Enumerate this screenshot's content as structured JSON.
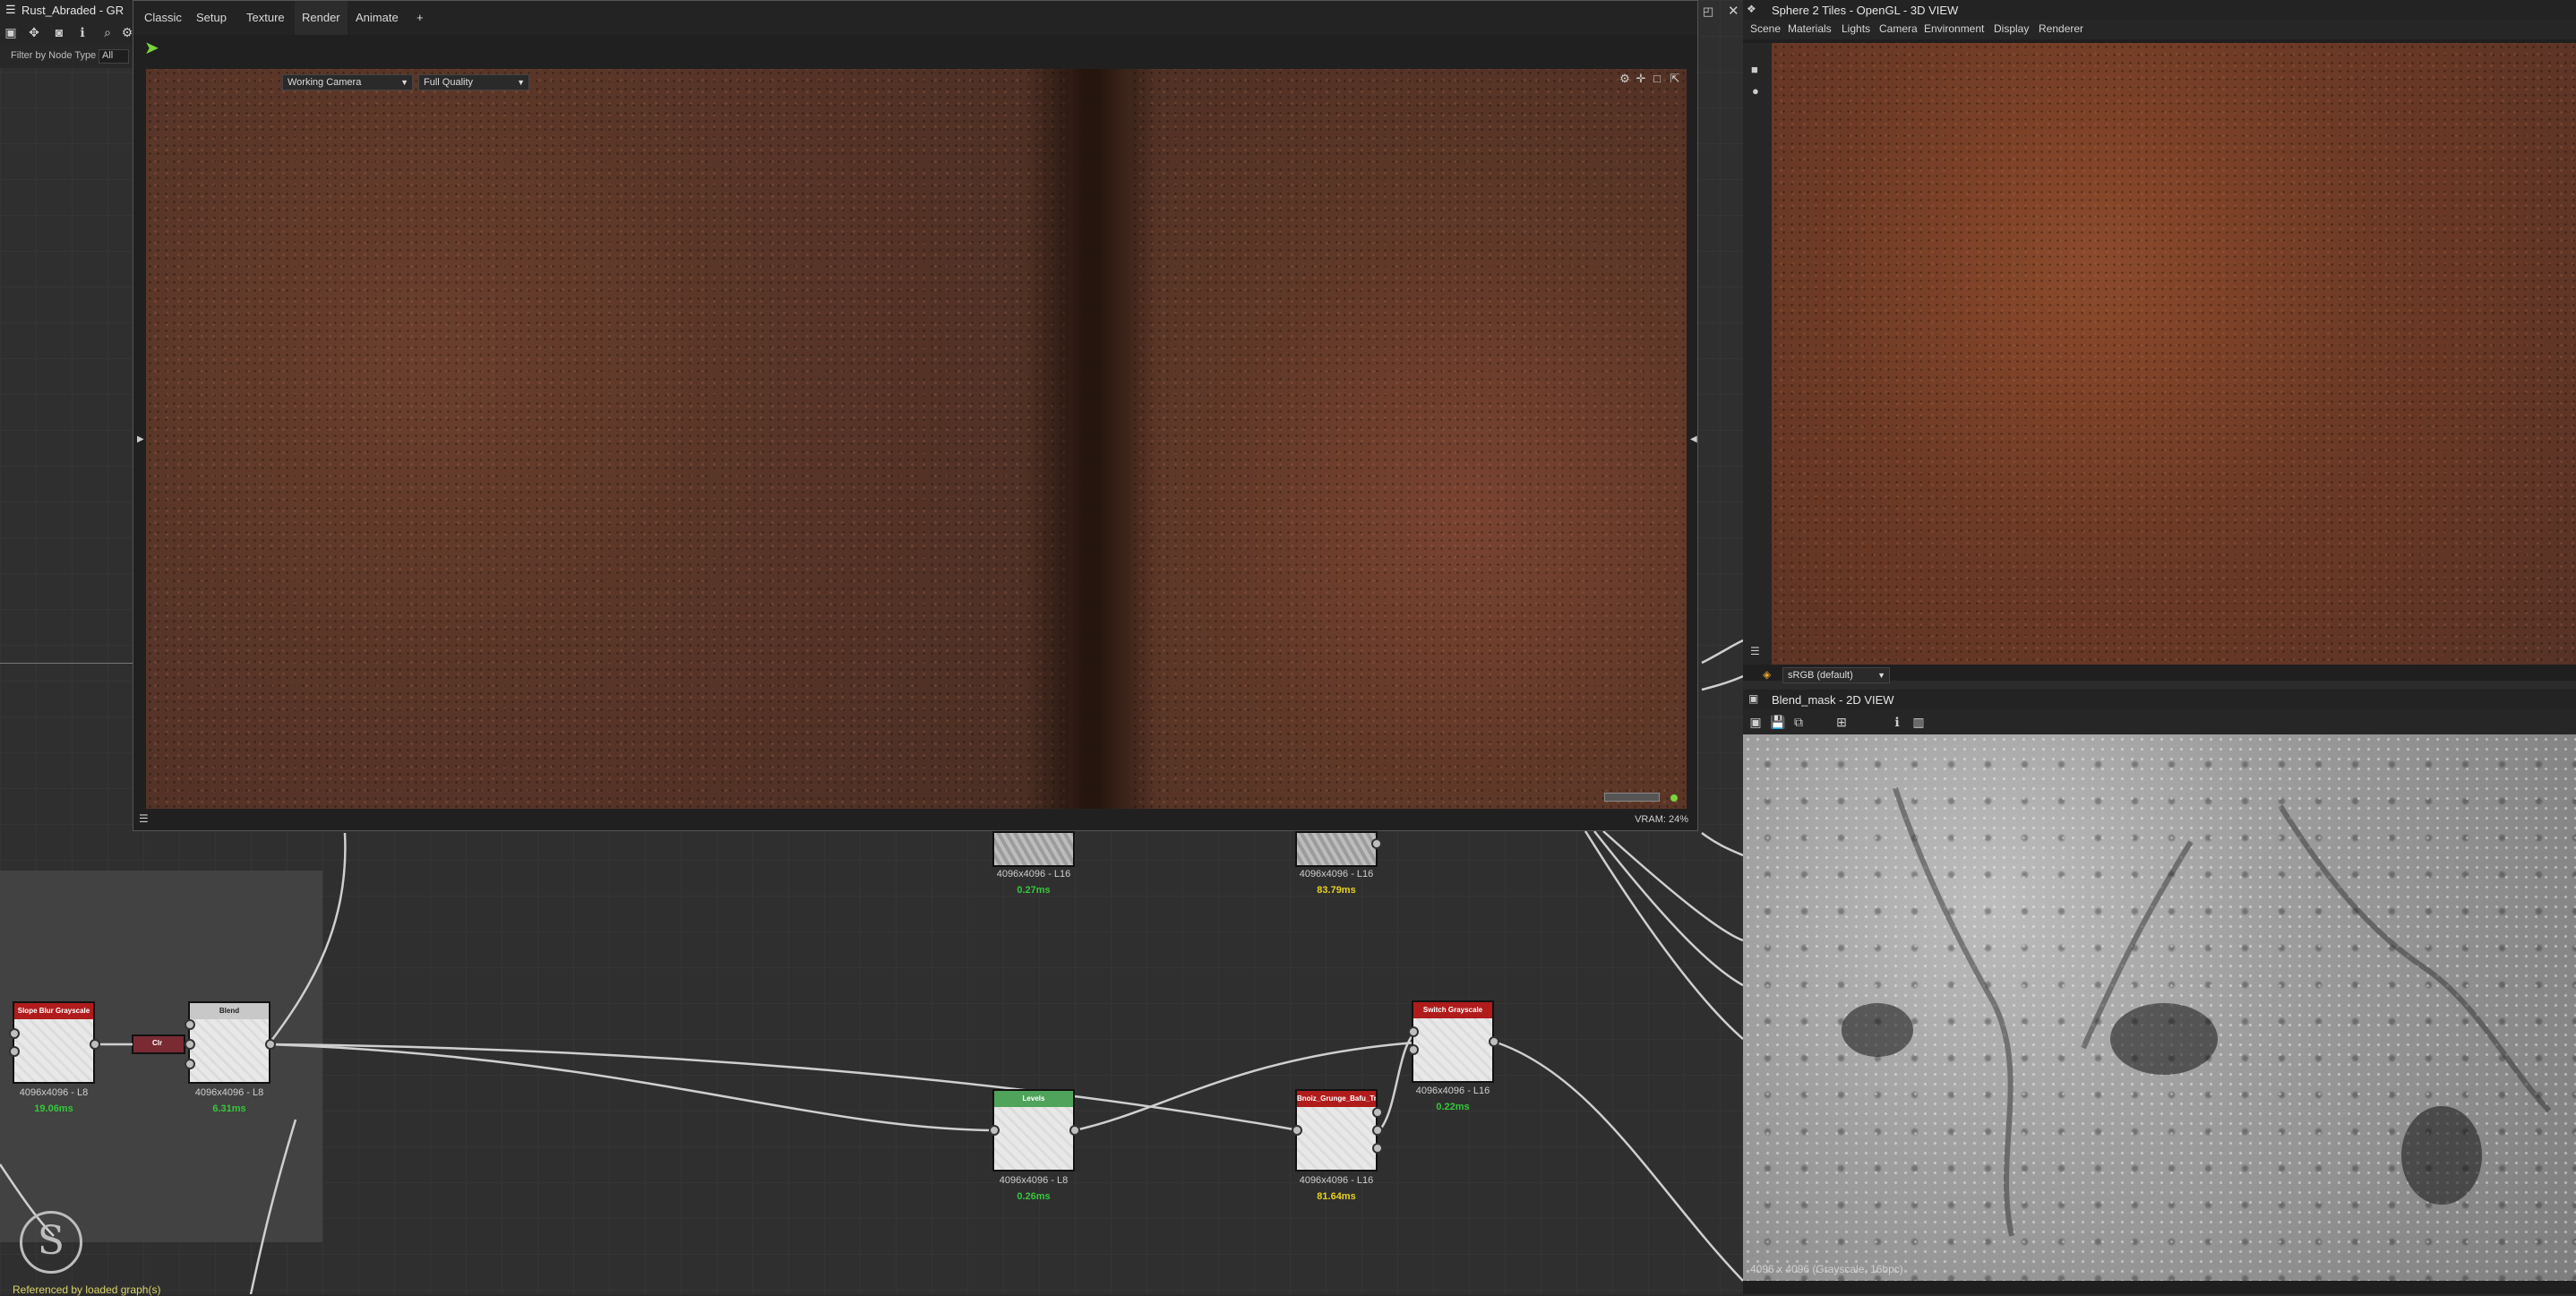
{
  "graph": {
    "title": "Rust_Abraded - GR",
    "filter_label": "Filter by Node Type",
    "filter_value": "All",
    "referenced_text": "Referenced by loaded graph(s)",
    "nodes": [
      {
        "name": "Slope Blur Grayscale",
        "size": "4096x4096 - L8",
        "time": "19.06ms",
        "header_color": "#b01c1c"
      },
      {
        "name": "Blend",
        "size": "4096x4096 - L8",
        "time": "6.31ms",
        "header_color": "#c8c8c8"
      },
      {
        "name": "Levels",
        "size": "4096x4096 - L8",
        "time": "0.26ms",
        "header_color": "#4fa35a"
      },
      {
        "name": "Bnoiz_Grunge_Bafu_Tr...",
        "size": "4096x4096 - L16",
        "time": "81.64ms",
        "header_color": "#b01c1c"
      },
      {
        "name": "Switch Grayscale",
        "size": "4096x4096 - L16",
        "time": "0.22ms",
        "header_color": "#b01c1c"
      }
    ],
    "top_nodes": [
      {
        "size": "4096x4096 - L16",
        "time": "0.27ms"
      },
      {
        "size": "4096x4096 - L16",
        "time": "83.79ms"
      }
    ],
    "mini_node_label": "Clr"
  },
  "render_window": {
    "tabs": [
      "Classic",
      "Setup",
      "Texture",
      "Render",
      "Animate",
      "+"
    ],
    "active_tab": "Render",
    "camera": "Working Camera",
    "quality": "Full Quality",
    "vram": "VRAM: 24%"
  },
  "view3d": {
    "title": "Sphere 2 Tiles - OpenGL - 3D VIEW",
    "menu": [
      "Scene",
      "Materials",
      "Lights",
      "Camera",
      "Environment",
      "Display",
      "Renderer"
    ],
    "colorspace": "sRGB (default)"
  },
  "view2d": {
    "title": "Blend_mask - 2D VIEW",
    "status": "4096 x 4096 (Grayscale, 16bpc)"
  },
  "colors": {
    "time_green": "#35c83a",
    "time_yellow": "#e6d021",
    "accent_green": "#7bd33b"
  }
}
